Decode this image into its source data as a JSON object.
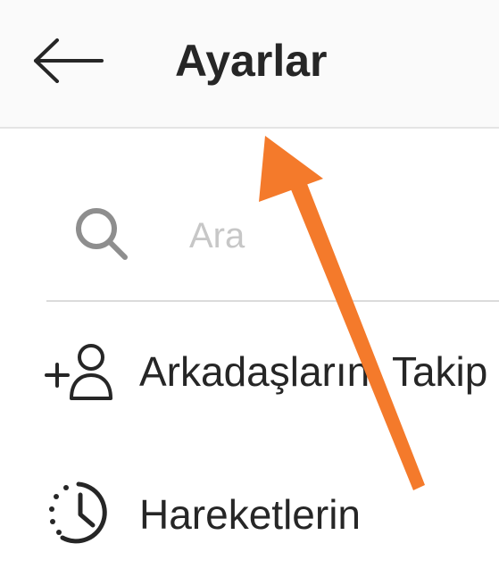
{
  "header": {
    "back_icon": "arrow-left-icon",
    "title": "Ayarlar"
  },
  "search": {
    "icon": "search-icon",
    "placeholder": "Ara"
  },
  "menu": {
    "items": [
      {
        "icon": "add-person-icon",
        "label": "Arkadaşlarını Takip Et"
      },
      {
        "icon": "activity-clock-icon",
        "label": "Hareketlerin"
      }
    ]
  },
  "annotation": {
    "arrow_color": "#f47a2b"
  }
}
